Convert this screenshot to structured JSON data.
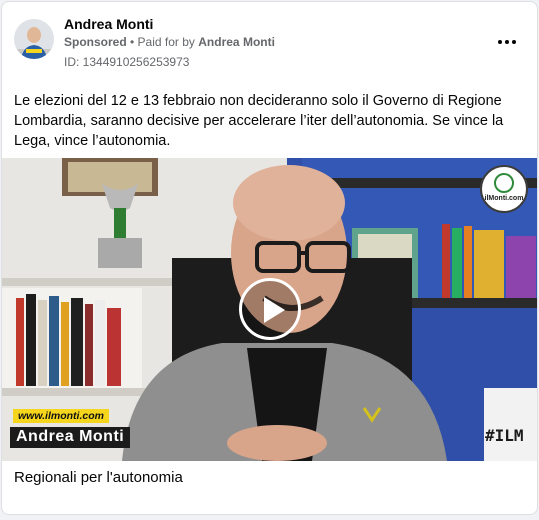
{
  "post": {
    "page_name": "Andrea Monti",
    "sponsored_label": "Sponsored",
    "separator": " • ",
    "paid_for_by_label": "Paid for by",
    "paid_for_by_name": "Andrea Monti",
    "ad_id": "ID: 1344910256253973",
    "more_icon": "more-horizontal-icon",
    "text": "Le elezioni del 12 e 13 febbraio non decideranno solo il Governo di Regione Lombardia, saranno decisive per accelerare l’iter dell’autonomia. Se vince la Lega, vince l’autonomia."
  },
  "video": {
    "play_icon": "play-icon",
    "url_overlay": "www.ilmonti.com",
    "name_overlay": "Andrea Monti",
    "badge_text": "ilMonti.com",
    "lightbox_text": "#ILM"
  },
  "caption": "Regionali per l'autonomia"
}
